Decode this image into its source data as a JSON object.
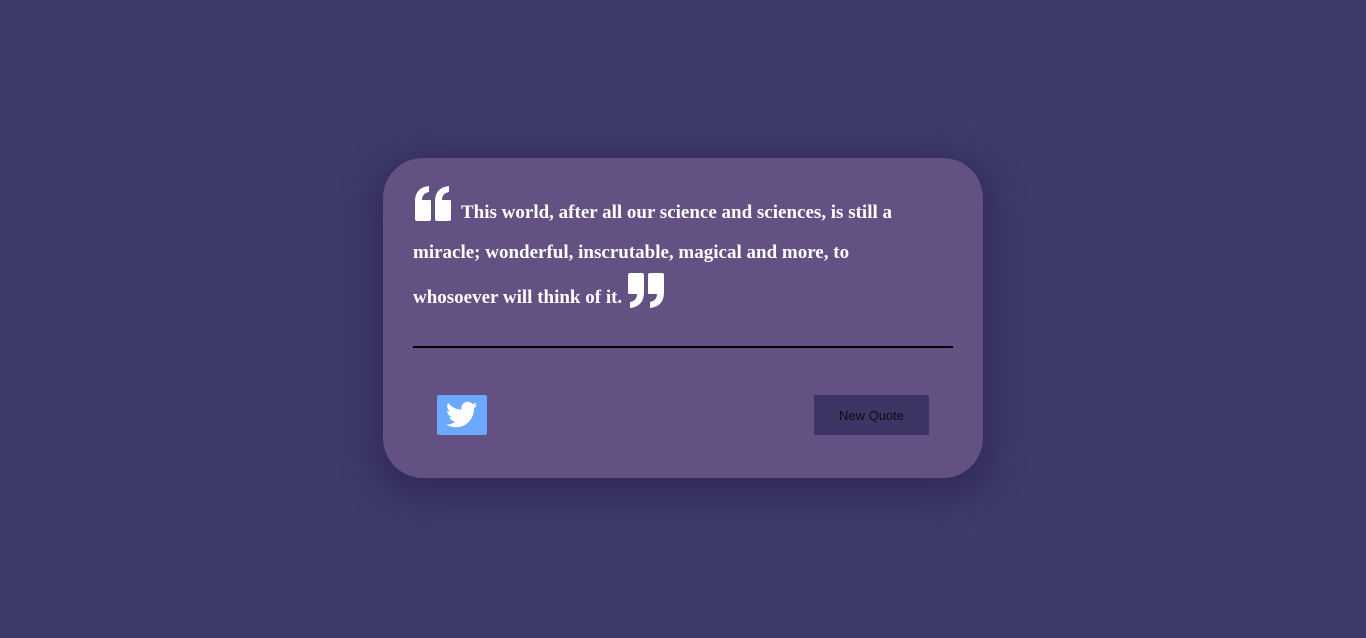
{
  "colors": {
    "page_background": "#3f3a6c",
    "card_background": "#635183",
    "quote_text": "#ffffff",
    "divider": "#000000",
    "tweet_button": "#6aa9ff",
    "new_quote_button": "#3d3566"
  },
  "quote": {
    "open_icon": "quote-left-icon",
    "text": "This world, after all our science and sciences, is still a miracle; wonderful, inscrutable, magical and more, to whosoever will think of it.",
    "close_icon": "quote-right-icon"
  },
  "actions": {
    "tweet_icon": "twitter-icon",
    "new_quote_label": "New Quote"
  }
}
